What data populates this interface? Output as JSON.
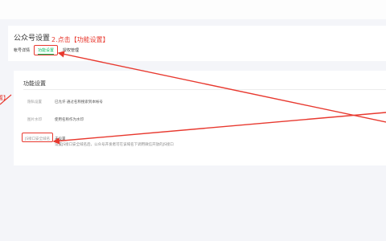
{
  "header": {
    "title": "公众号设置",
    "tabs": [
      {
        "label": "帐号详情"
      },
      {
        "label": "功能设置"
      },
      {
        "label": "授权管理"
      }
    ]
  },
  "annotations": {
    "step2": "2.点击【功能设置】",
    "left_fragment": "置】"
  },
  "section": {
    "title": "功能设置",
    "rows": [
      {
        "label": "隐私设置",
        "value": "已允许 通过名称搜索到本帐号"
      },
      {
        "label": "图片水印",
        "value": "使用名称作为水印"
      },
      {
        "label": "JS接口安全域名",
        "value": "未设置",
        "description": "设置JS接口安全域名后，公众号开发者可在该域名下调用微信开放的JS接口"
      }
    ]
  },
  "colors": {
    "accent": "#07c160",
    "annotation": "#e8392f"
  }
}
